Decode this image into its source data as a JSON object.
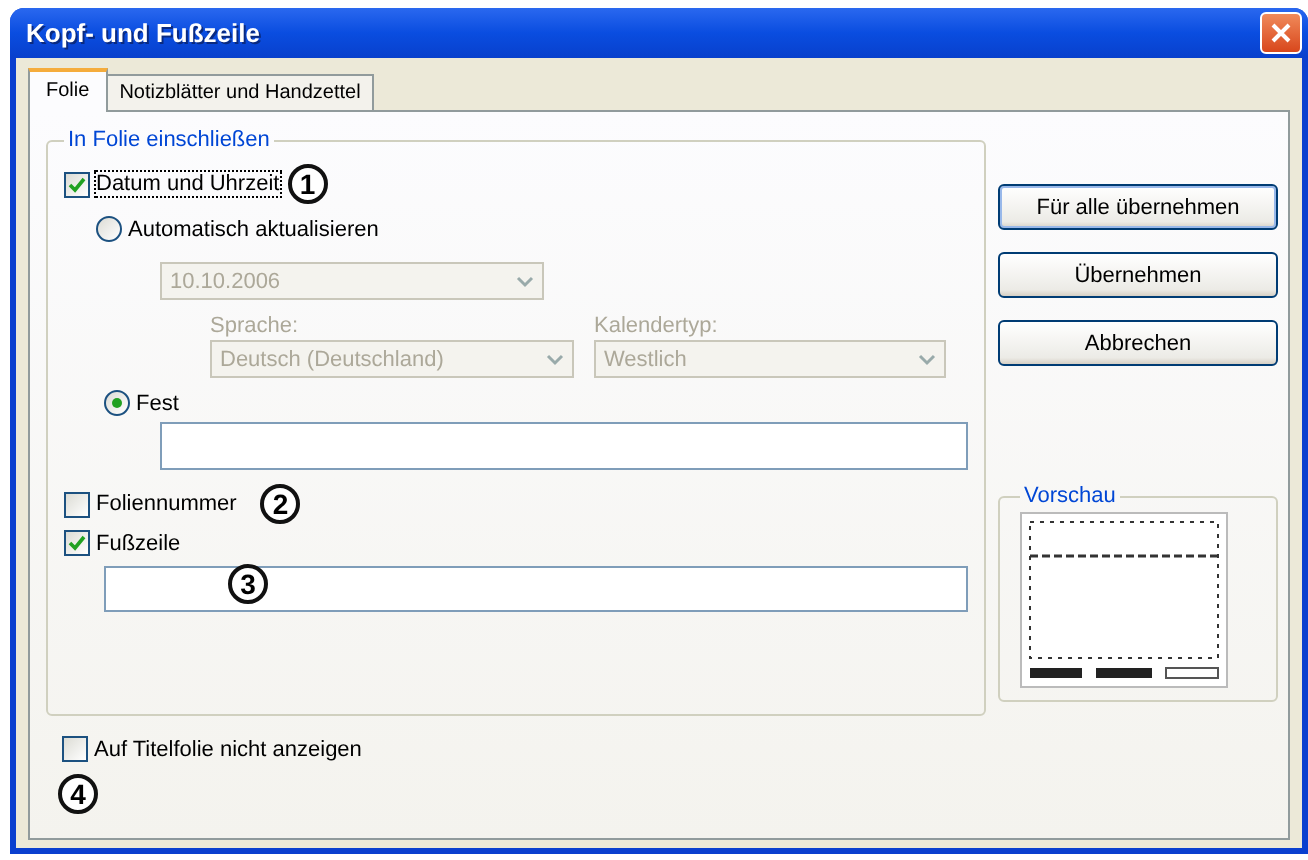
{
  "window": {
    "title": "Kopf- und Fußzeile"
  },
  "tabs": [
    {
      "label": "Folie",
      "selected": true
    },
    {
      "label": "Notizblätter und Handzettel",
      "selected": false
    }
  ],
  "group": {
    "title": "In Folie einschließen",
    "date_time": {
      "label": "Datum und Uhrzeit",
      "checked": true,
      "callout": "1"
    },
    "auto_update": {
      "label": "Automatisch aktualisieren",
      "selected": false
    },
    "date_format": {
      "value": "10.10.2006",
      "disabled": true
    },
    "language": {
      "label": "Sprache:",
      "value": "Deutsch (Deutschland)",
      "disabled": true
    },
    "calendar": {
      "label": "Kalendertyp:",
      "value": "Westlich",
      "disabled": true
    },
    "fixed": {
      "label": "Fest",
      "selected": true
    },
    "slide_number": {
      "label": "Foliennummer",
      "checked": false,
      "callout": "2"
    },
    "footer": {
      "label": "Fußzeile",
      "checked": true,
      "callout": "3"
    }
  },
  "hide_on_title": {
    "label": "Auf Titelfolie nicht anzeigen",
    "checked": false,
    "callout": "4"
  },
  "buttons": [
    "Für alle übernehmen",
    "Übernehmen",
    "Abbrechen"
  ],
  "preview": {
    "title": "Vorschau"
  }
}
